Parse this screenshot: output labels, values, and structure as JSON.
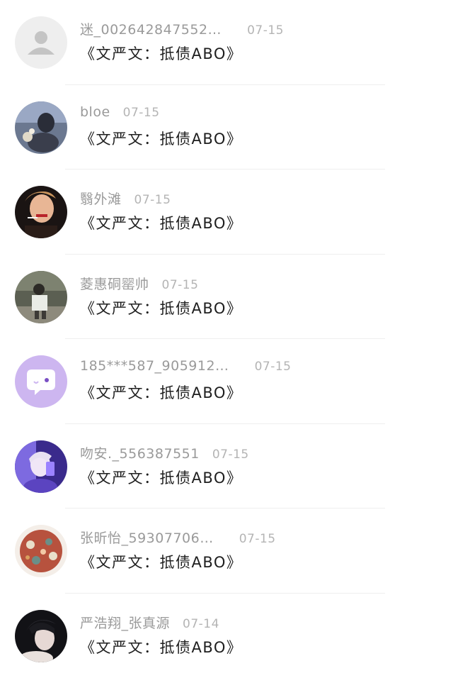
{
  "comments": [
    {
      "user": "迷_002642847552…",
      "date": "07-15",
      "text": "《文严文：抵债ABO》",
      "avatar_icon": "default-user-icon"
    },
    {
      "user": "bloe",
      "date": "07-15",
      "text": "《文严文：抵债ABO》",
      "avatar_icon": "photo-avatar"
    },
    {
      "user": "翳外滩",
      "date": "07-15",
      "text": "《文严文：抵债ABO》",
      "avatar_icon": "photo-avatar"
    },
    {
      "user": "菱惠硐罂帅",
      "date": "07-15",
      "text": "《文严文：抵债ABO》",
      "avatar_icon": "photo-avatar"
    },
    {
      "user": "185***587_905912…",
      "date": "07-15",
      "text": "《文严文：抵债ABO》",
      "avatar_icon": "chat-bubble-icon"
    },
    {
      "user": "吻安._556387551",
      "date": "07-15",
      "text": "《文严文：抵债ABO》",
      "avatar_icon": "photo-avatar"
    },
    {
      "user": "张昕怡_59307706…",
      "date": "07-15",
      "text": "《文严文：抵债ABO》",
      "avatar_icon": "photo-avatar"
    },
    {
      "user": "严浩翔_张真源",
      "date": "07-14",
      "text": "《文严文：抵债ABO》",
      "avatar_icon": "photo-avatar"
    }
  ],
  "colors": {
    "username": "#9a9a9a",
    "date": "#b4b4b4",
    "comment": "#1e1e1e",
    "divider": "#eeeeee",
    "chat_avatar_bg": "#cdb6f0"
  }
}
